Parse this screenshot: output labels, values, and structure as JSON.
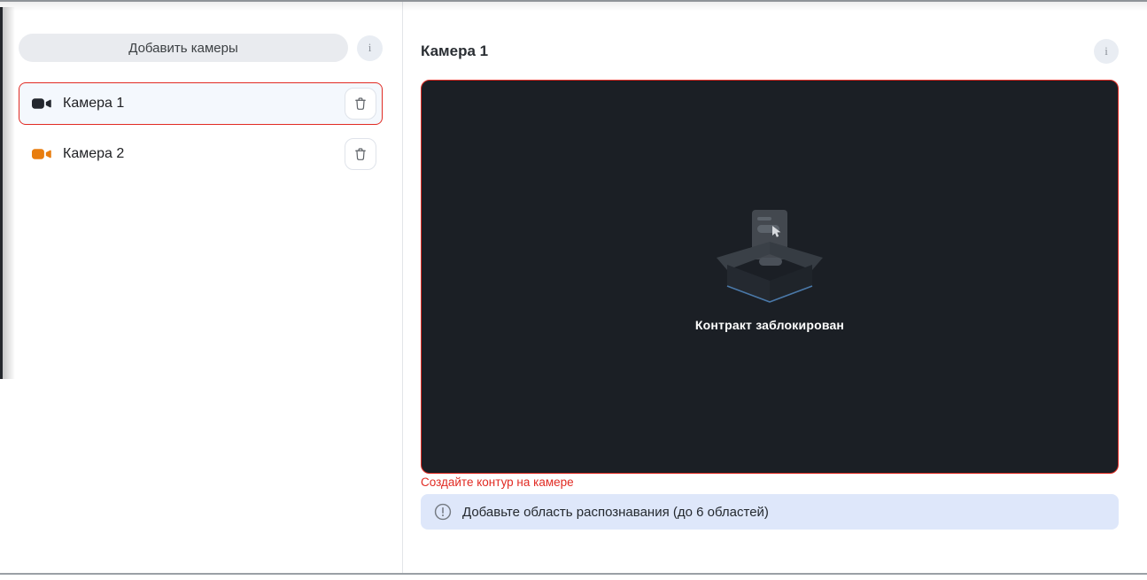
{
  "sidebar": {
    "add_button_label": "Добавить камеры",
    "info_button_label": "i",
    "cameras": [
      {
        "name": "Камера 1",
        "icon_color": "#23272e",
        "selected": true
      },
      {
        "name": "Камера 2",
        "icon_color": "#e87d0e",
        "selected": false
      }
    ]
  },
  "main": {
    "title": "Камера 1",
    "info_button_label": "i",
    "preview_status": "Контракт заблокирован",
    "error_message": "Создайте контур на камере",
    "banner_message": "Добавьте область распознавания (до 6 областей)"
  },
  "colors": {
    "accent_red": "#e12b23",
    "selected_row_bg": "#f4f8fd",
    "preview_bg": "#1b1f25",
    "banner_bg": "#dee7fa",
    "camera1_icon": "#23272e",
    "camera2_icon": "#e87d0e"
  }
}
